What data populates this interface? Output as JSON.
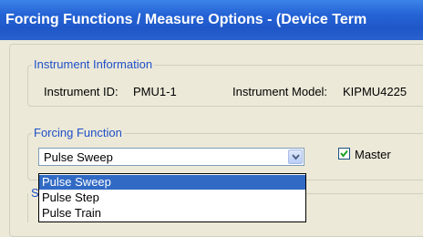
{
  "window": {
    "title": "Forcing Functions / Measure Options - (Device Term"
  },
  "instrument_info": {
    "legend": "Instrument Information",
    "id_label": "Instrument ID:",
    "id_value": "PMU1-1",
    "model_label": "Instrument Model:",
    "model_value": "KIPMU4225"
  },
  "forcing_function": {
    "legend": "Forcing Function",
    "selected": "Pulse Sweep",
    "options": [
      "Pulse Sweep",
      "Pulse Step",
      "Pulse Train"
    ],
    "master_label": "Master",
    "master_checked": true
  },
  "partial_group": {
    "legend_fragment": "S"
  }
}
